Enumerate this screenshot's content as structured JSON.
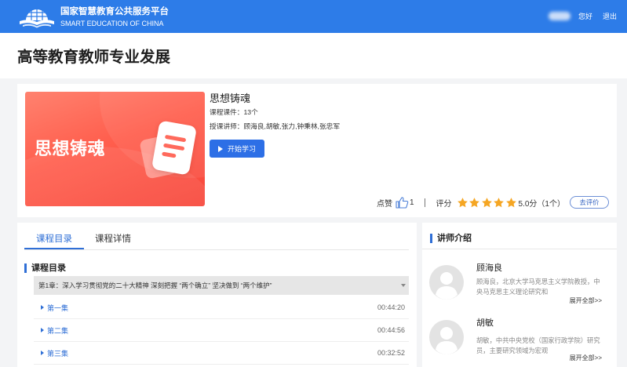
{
  "theme": {
    "primary": "#2d7ce8",
    "button": "#2d6fe6",
    "link": "#2f6fd6",
    "star": "#f5a623",
    "page_bg": "#f3f4f6",
    "thumbnail_red": "#ff5e4d"
  },
  "icons": {
    "logo": "platform-logo-icon",
    "play": "play-icon",
    "like": "thumbs-up-icon",
    "star": "star-icon",
    "chapter_toggle": "caret-down-icon",
    "episode_bullet": "triangle-right-icon",
    "avatar": "avatar-placeholder-icon",
    "thumbnail_art": "document-icon"
  },
  "header": {
    "platform_name": "国家智慧教育公共服务平台",
    "platform_name_en": "SMART EDUCATION OF CHINA",
    "greeting": "您好",
    "logout": "退出"
  },
  "page_title": "高等教育教师专业发展",
  "course": {
    "thumbnail_text": "思想铸魂",
    "title": "思想铸魂",
    "courseware": "课程课件：13个",
    "lecturers": "授课讲师：顾海良,胡敏,张力,钟秉林,张忠军",
    "start_button": "开始学习",
    "like_label": "点赞",
    "like_count": "1",
    "rating_label": "评分",
    "rating_stars": 5,
    "rating_text": "5.0分（1个）",
    "rate_button": "去评价"
  },
  "tabs": {
    "active_index": 0,
    "items": [
      {
        "label": "课程目录"
      },
      {
        "label": "课程详情"
      }
    ]
  },
  "catalog": {
    "heading": "课程目录",
    "chapter": "第1章：深入学习贯彻党的二十大精神 深刻把握 “两个确立” 坚决做到 “两个维护”",
    "episodes": [
      {
        "title": "第一集",
        "duration": "00:44:20"
      },
      {
        "title": "第二集",
        "duration": "00:44:56"
      },
      {
        "title": "第三集",
        "duration": "00:32:52"
      }
    ]
  },
  "instructors": {
    "heading": "讲师介绍",
    "items": [
      {
        "name": "顾海良",
        "bio": "顾海良，北京大学马克思主义学院教授，中央马克思主义理论研究和",
        "more": "展开全部>>"
      },
      {
        "name": "胡敏",
        "bio": "胡敏，中共中央党校（国家行政学院）研究员，主要研究领域为宏观",
        "more": "展开全部>>"
      }
    ]
  }
}
